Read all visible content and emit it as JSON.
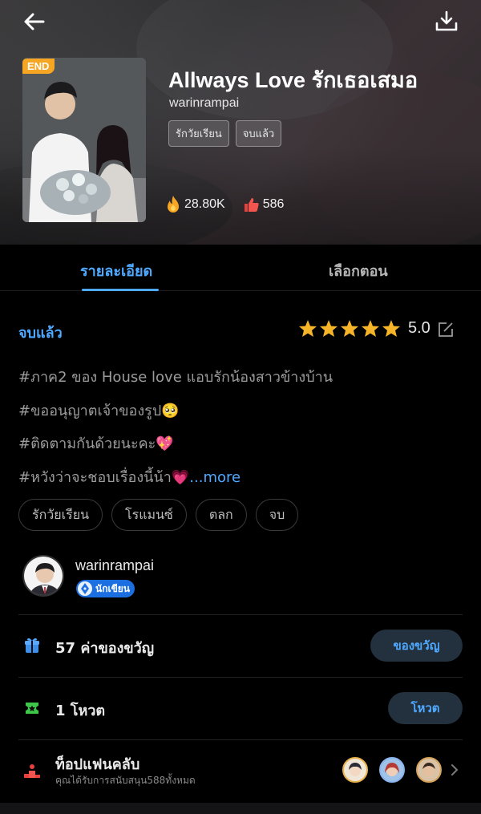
{
  "header": {
    "back_icon": "arrow-left-icon",
    "download_icon": "download-icon",
    "badge": "END",
    "title": "Allways Love รักเธอเสมอ",
    "author": "warinrampai",
    "tags": [
      "รักวัยเรียน",
      "จบแล้ว"
    ],
    "views": "28.80K",
    "likes": "586"
  },
  "tabs": [
    {
      "label": "รายละเอียด",
      "active": true
    },
    {
      "label": "เลือกตอน",
      "active": false
    }
  ],
  "details": {
    "status": "จบแล้ว",
    "rating": "5.0",
    "stars": 5,
    "description": [
      "#ภาค2 ของ House love แอบรักน้องสาวข้างบ้าน",
      "#ขออนุญาตเจ้าของรูป🥺",
      "#ติดตามกันด้วยนะคะ💖",
      "#หวังว่าจะชอบเรื่องนี้น้า💗"
    ],
    "more": "...more",
    "chips": [
      "รักวัยเรียน",
      "โรแมนซ์",
      "ตลก",
      "จบ"
    ]
  },
  "author_card": {
    "name": "warinrampai",
    "badge": "นักเขียน"
  },
  "gift_row": {
    "label": "57 ค่าของขวัญ",
    "button": "ของขวัญ"
  },
  "vote_row": {
    "label": "1 โหวต",
    "button": "โหวต"
  },
  "fanclub": {
    "title": "ท็อปแฟนคลับ",
    "subtitle": "คุณได้รับการสนับสนุน588ทั้งหมด"
  },
  "colors": {
    "accent": "#4fa9ff",
    "star": "#f6b428",
    "end_badge": "#f6a623"
  }
}
